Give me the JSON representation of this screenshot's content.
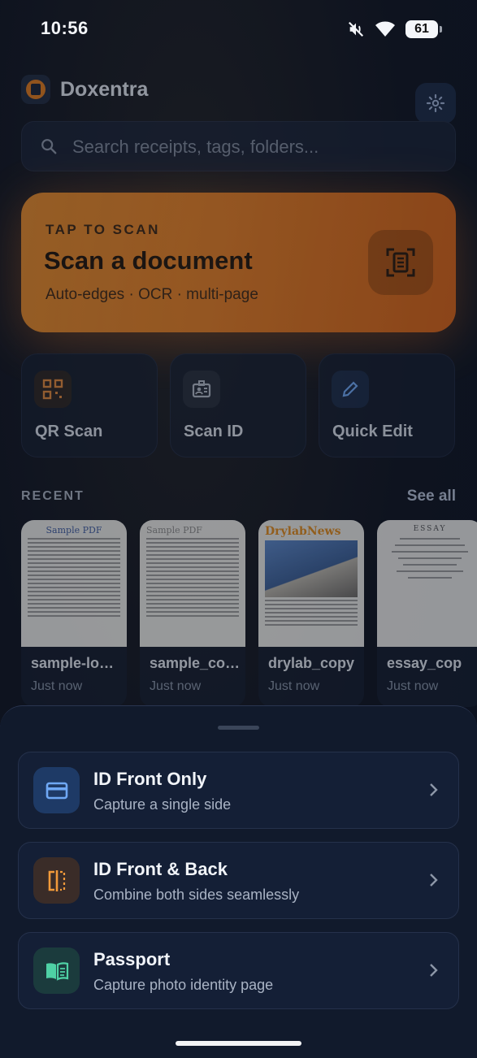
{
  "status_bar": {
    "time": "10:56",
    "battery": "61"
  },
  "header": {
    "app_name": "Doxentra"
  },
  "search": {
    "placeholder": "Search receipts, tags, folders..."
  },
  "scan_card": {
    "kicker": "TAP TO SCAN",
    "title": "Scan a document",
    "subtitle": "Auto-edges · OCR · multi-page"
  },
  "quick_actions": [
    {
      "label": "QR Scan",
      "icon": "qr-icon"
    },
    {
      "label": "Scan ID",
      "icon": "id-badge-icon"
    },
    {
      "label": "Quick Edit",
      "icon": "pencil-icon"
    }
  ],
  "recent": {
    "label": "RECENT",
    "see_all": "See all",
    "items": [
      {
        "name": "sample-lo…",
        "time": "Just now",
        "thumb_title": "Sample PDF"
      },
      {
        "name": "sample_co…",
        "time": "Just now",
        "thumb_title": "Sample PDF"
      },
      {
        "name": "drylab_copy",
        "time": "Just now",
        "thumb_title": "DrylabNews"
      },
      {
        "name": "essay_cop",
        "time": "Just now",
        "thumb_title": "ESSAY"
      }
    ]
  },
  "sheet": {
    "options": [
      {
        "title": "ID Front Only",
        "subtitle": "Capture a single side",
        "icon": "card-icon",
        "color": "#6fa8f5"
      },
      {
        "title": "ID Front & Back",
        "subtitle": "Combine both sides seamlessly",
        "icon": "flip-icon",
        "color": "#f29a3a"
      },
      {
        "title": "Passport",
        "subtitle": "Capture photo identity page",
        "icon": "passport-icon",
        "color": "#4fd1a5"
      }
    ]
  },
  "colors": {
    "accent": "#e07a22",
    "background": "#0d1320",
    "sheet": "#111a2c"
  }
}
